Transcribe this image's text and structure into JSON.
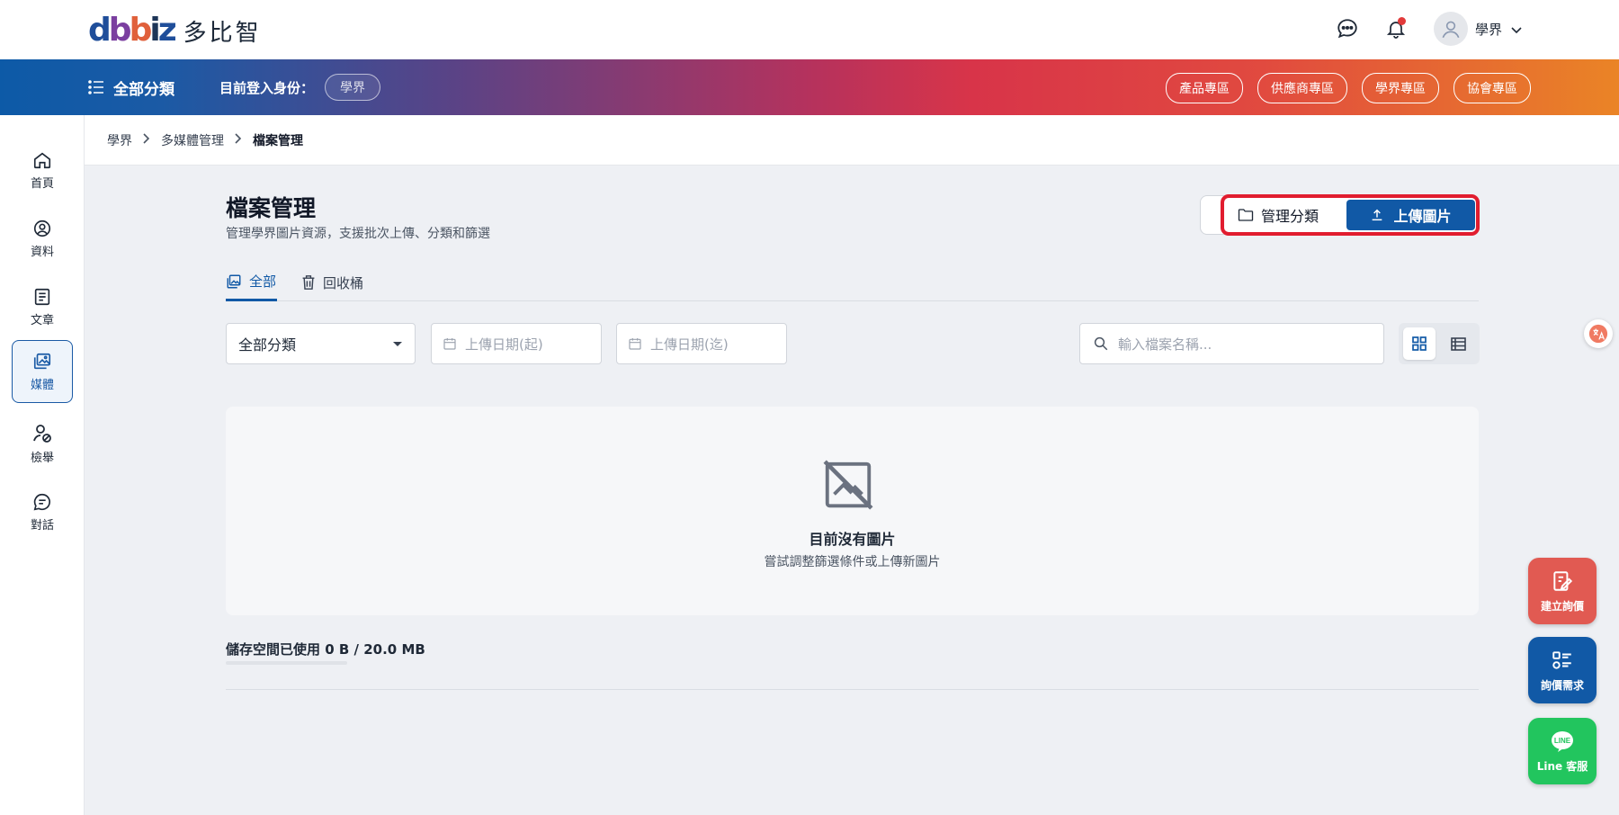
{
  "header": {
    "logo_mark": "dbbiz",
    "logo_text": "多比智",
    "user_name": "學界"
  },
  "band": {
    "all_categories": "全部分類",
    "login_as_label": "目前登入身份：",
    "role": "學界",
    "zones": [
      "產品專區",
      "供應商專區",
      "學界專區",
      "協會專區"
    ]
  },
  "sidebar": {
    "items": [
      {
        "label": "首頁",
        "icon": "home-icon"
      },
      {
        "label": "資料",
        "icon": "user-circle-icon"
      },
      {
        "label": "文章",
        "icon": "article-icon"
      },
      {
        "label": "媒體",
        "icon": "media-icon",
        "active": true
      },
      {
        "label": "檢舉",
        "icon": "report-icon"
      },
      {
        "label": "對話",
        "icon": "chat-icon"
      }
    ]
  },
  "breadcrumb": {
    "items": [
      "學界",
      "多媒體管理",
      "檔案管理"
    ]
  },
  "page": {
    "title": "檔案管理",
    "subtitle": "管理學界圖片資源，支援批次上傳、分類和篩選",
    "manage_label": "管理分類",
    "upload_label": "上傳圖片"
  },
  "tabs": {
    "all": "全部",
    "trash": "回收桶"
  },
  "filters": {
    "category_value": "全部分類",
    "date_start_placeholder": "上傳日期(起)",
    "date_end_placeholder": "上傳日期(迄)",
    "search_placeholder": "輸入檔案名稱..."
  },
  "empty": {
    "title": "目前沒有圖片",
    "subtitle": "嘗試調整篩選條件或上傳新圖片"
  },
  "storage": {
    "label": "儲存空間已使用 0 B / 20.0 MB",
    "used_fraction": 0
  },
  "fabs": {
    "quote": "建立詢價",
    "demand": "詢價需求",
    "line": "Line 客服"
  },
  "colors": {
    "primary": "#1159a6",
    "highlight": "#e11d2f",
    "fab_quote": "#e15a52",
    "fab_line": "#22c55e"
  }
}
